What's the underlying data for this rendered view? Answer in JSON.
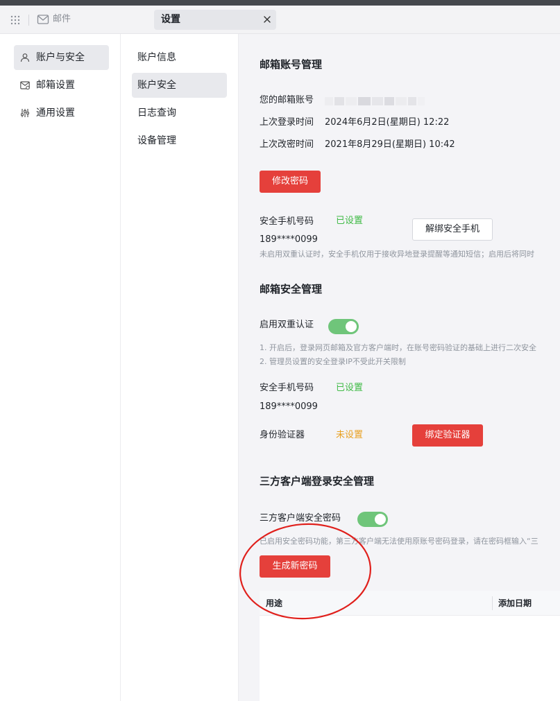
{
  "titlebar": {
    "app_label": "邮件",
    "tab_label": "设置",
    "icons": [
      "grid-icon",
      "mail-icon",
      "close-icon"
    ]
  },
  "sidebar": {
    "items": [
      {
        "label": "账户与安全",
        "icon": "user-icon",
        "active": true
      },
      {
        "label": "邮箱设置",
        "icon": "mailbox-settings-icon",
        "active": false
      },
      {
        "label": "通用设置",
        "icon": "sliders-icon",
        "active": false
      }
    ]
  },
  "subnav": {
    "items": [
      {
        "label": "账户信息",
        "active": false
      },
      {
        "label": "账户安全",
        "active": true
      },
      {
        "label": "日志查询",
        "active": false
      },
      {
        "label": "设备管理",
        "active": false
      }
    ]
  },
  "account": {
    "title": "邮箱账号管理",
    "email_label": "您的邮箱账号",
    "last_login_label": "上次登录时间",
    "last_login_value": "2024年6月2日(星期日) 12:22",
    "last_pwd_label": "上次改密时间",
    "last_pwd_value": "2021年8月29日(星期日) 10:42",
    "change_pwd_button": "修改密码",
    "phone_label": "安全手机号码",
    "phone_status": "已设置",
    "phone_value": "189****0099",
    "unbind_button": "解绑安全手机",
    "phone_note": "未启用双重认证时，安全手机仅用于接收异地登录提醒等通知短信；启用后将同时"
  },
  "security": {
    "title": "邮箱安全管理",
    "twofa_label": "启用双重认证",
    "twofa_enabled": true,
    "note1": "1. 开启后，登录网页邮箱及官方客户端时，在账号密码验证的基础上进行二次安全",
    "note2": "2. 管理员设置的安全登录IP不受此开关限制",
    "phone_label": "安全手机号码",
    "phone_status": "已设置",
    "phone_value": "189****0099",
    "auth_label": "身份验证器",
    "auth_status": "未设置",
    "bind_button": "绑定验证器"
  },
  "thirdparty": {
    "title": "三方客户端登录安全管理",
    "pwd_label": "三方客户端安全密码",
    "pwd_enabled": true,
    "note": "已启用安全密码功能，第三方客户端无法使用原账号密码登录，请在密码框输入“三",
    "generate_button": "生成新密码",
    "columns": [
      "用途",
      "添加日期"
    ]
  },
  "colors": {
    "accent_red": "#e5403b",
    "success_green": "#3fba46",
    "warning_orange": "#e8a020",
    "toggle_on": "#6fc57a",
    "annotation_red": "#e0201c"
  }
}
